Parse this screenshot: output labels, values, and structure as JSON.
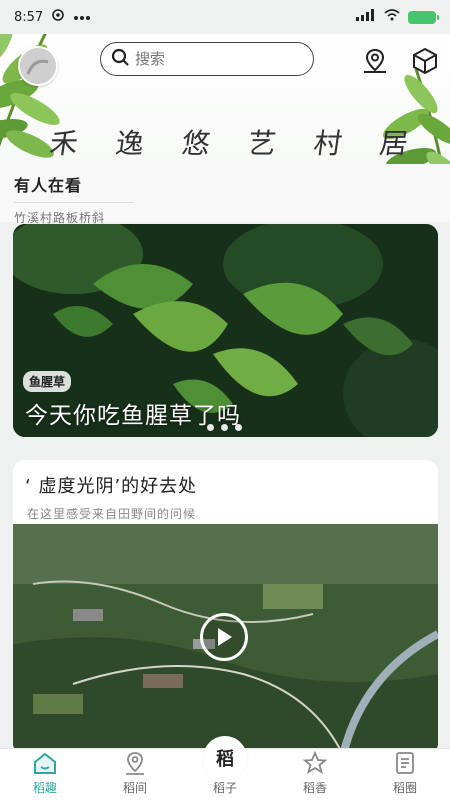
{
  "status_bar": {
    "time": "8:57",
    "left_icons": [
      "weibo-icon",
      "more-dots-icon"
    ],
    "right_icons": [
      "signal-icon",
      "wifi-icon",
      "battery-icon"
    ],
    "battery_color": "#47c46d"
  },
  "header": {
    "search_placeholder": "搜索",
    "calligraphy_chars": [
      "禾",
      "逸",
      "悠",
      "艺",
      "村",
      "居"
    ],
    "icons": [
      "map-pin-icon",
      "cube-icon"
    ]
  },
  "watching": {
    "title": "有人在看",
    "subtitle": "竹溪村路板桥斜"
  },
  "feature": {
    "tag": "鱼腥草",
    "title": "今天你吃鱼腥草了吗",
    "dots": 3
  },
  "card2": {
    "title": "‘ 虚度光阴’的好去处",
    "subtitle": "在这里感受来自田野间的问候"
  },
  "bottom_nav": {
    "items": [
      {
        "label": "稻趣",
        "icon": "home-icon",
        "active": true
      },
      {
        "label": "稻间",
        "icon": "location-icon",
        "active": false
      },
      {
        "label": "稻子",
        "icon": "center-logo",
        "active": false
      },
      {
        "label": "稻香",
        "icon": "star-icon",
        "active": false
      },
      {
        "label": "稻圈",
        "icon": "note-icon",
        "active": false
      }
    ],
    "center_glyph": "稻",
    "accent": "#2fa7a0"
  }
}
